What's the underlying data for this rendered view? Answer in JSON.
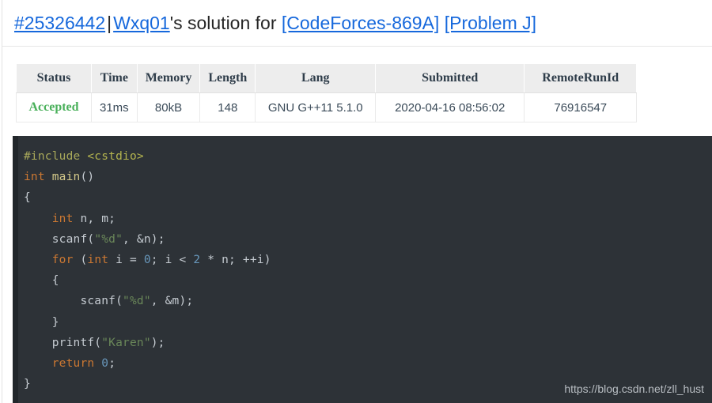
{
  "header": {
    "submission_id": "#25326442",
    "separator": "|",
    "user": "Wxq01",
    "middle_text": "'s solution for",
    "problem_source": "[CodeForces-869A]",
    "problem_label": "[Problem J]",
    "link_color": "#1668dc",
    "text_color": "#262626"
  },
  "table": {
    "columns": [
      "Status",
      "Time",
      "Memory",
      "Length",
      "Lang",
      "Submitted",
      "RemoteRunId"
    ],
    "rows": [
      {
        "status": "Accepted",
        "status_color": "#49b05a",
        "time": "31ms",
        "memory": "80kB",
        "length": "148",
        "lang": "GNU G++11 5.1.0",
        "submitted": "2020-04-16 08:56:02",
        "remote_run_id": "76916547"
      }
    ]
  },
  "code": {
    "language": "cpp",
    "background": "#2d3237",
    "lines": [
      [
        {
          "t": "#include ",
          "c": "pre"
        },
        {
          "t": "<cstdio>",
          "c": "hdr"
        }
      ],
      [
        {
          "t": "int",
          "c": "kw"
        },
        {
          "t": " ",
          "c": "txt"
        },
        {
          "t": "main",
          "c": "fn"
        },
        {
          "t": "()",
          "c": "txt"
        }
      ],
      [
        {
          "t": "{",
          "c": "txt"
        }
      ],
      [
        {
          "t": "    ",
          "c": "txt"
        },
        {
          "t": "int",
          "c": "kw"
        },
        {
          "t": " n, m;",
          "c": "txt"
        }
      ],
      [
        {
          "t": "    scanf(",
          "c": "txt"
        },
        {
          "t": "\"%d\"",
          "c": "str"
        },
        {
          "t": ", &n);",
          "c": "txt"
        }
      ],
      [
        {
          "t": "    ",
          "c": "txt"
        },
        {
          "t": "for",
          "c": "kw"
        },
        {
          "t": " (",
          "c": "txt"
        },
        {
          "t": "int",
          "c": "kw"
        },
        {
          "t": " i = ",
          "c": "txt"
        },
        {
          "t": "0",
          "c": "num"
        },
        {
          "t": "; i < ",
          "c": "txt"
        },
        {
          "t": "2",
          "c": "num"
        },
        {
          "t": " * n; ++i)",
          "c": "txt"
        }
      ],
      [
        {
          "t": "    {",
          "c": "txt"
        }
      ],
      [
        {
          "t": "        scanf(",
          "c": "txt"
        },
        {
          "t": "\"%d\"",
          "c": "str"
        },
        {
          "t": ", &m);",
          "c": "txt"
        }
      ],
      [
        {
          "t": "    }",
          "c": "txt"
        }
      ],
      [
        {
          "t": "    printf(",
          "c": "txt"
        },
        {
          "t": "\"Karen\"",
          "c": "str"
        },
        {
          "t": ");",
          "c": "txt"
        }
      ],
      [
        {
          "t": "    ",
          "c": "txt"
        },
        {
          "t": "return",
          "c": "kw"
        },
        {
          "t": " ",
          "c": "txt"
        },
        {
          "t": "0",
          "c": "num"
        },
        {
          "t": ";",
          "c": "txt"
        }
      ],
      [
        {
          "t": "}",
          "c": "txt"
        }
      ]
    ]
  },
  "watermark": {
    "text": "https://blog.csdn.net/zll_hust"
  }
}
